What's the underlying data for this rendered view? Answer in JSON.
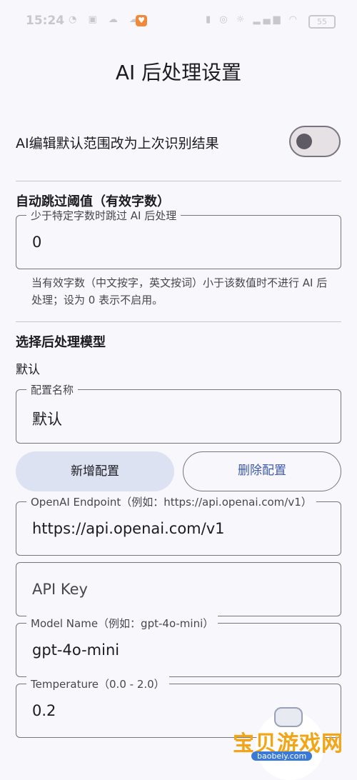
{
  "status_bar": {
    "time": "15:24"
  },
  "page": {
    "title": "AI 后处理设置"
  },
  "toggle": {
    "label": "AI编辑默认范围改为上次识别结果",
    "on": false
  },
  "auto_skip": {
    "section_title": "自动跳过阈值（有效字数）",
    "field_label": "少于特定字数时跳过 AI 后处理",
    "value": "0",
    "help": "当有效字数（中文按字，英文按词）小于该数值时不进行 AI 后处理；设为 0 表示不启用。"
  },
  "model": {
    "section_title": "选择后处理模型",
    "selected": "默认",
    "config_name_label": "配置名称",
    "config_name_value": "默认",
    "add_button": "新增配置",
    "delete_button": "删除配置",
    "endpoint_label": "OpenAI Endpoint（例如：https://api.openai.com/v1）",
    "endpoint_value": "https://api.openai.com/v1",
    "api_key_placeholder": "API Key",
    "model_name_label": "Model Name（例如：gpt-4o-mini）",
    "model_name_value": "gpt-4o-mini",
    "temperature_label": "Temperature（0.0 - 2.0）",
    "temperature_value": "0.2"
  },
  "watermark": {
    "text": "宝贝游戏网",
    "sub": "baobeiy.com"
  }
}
